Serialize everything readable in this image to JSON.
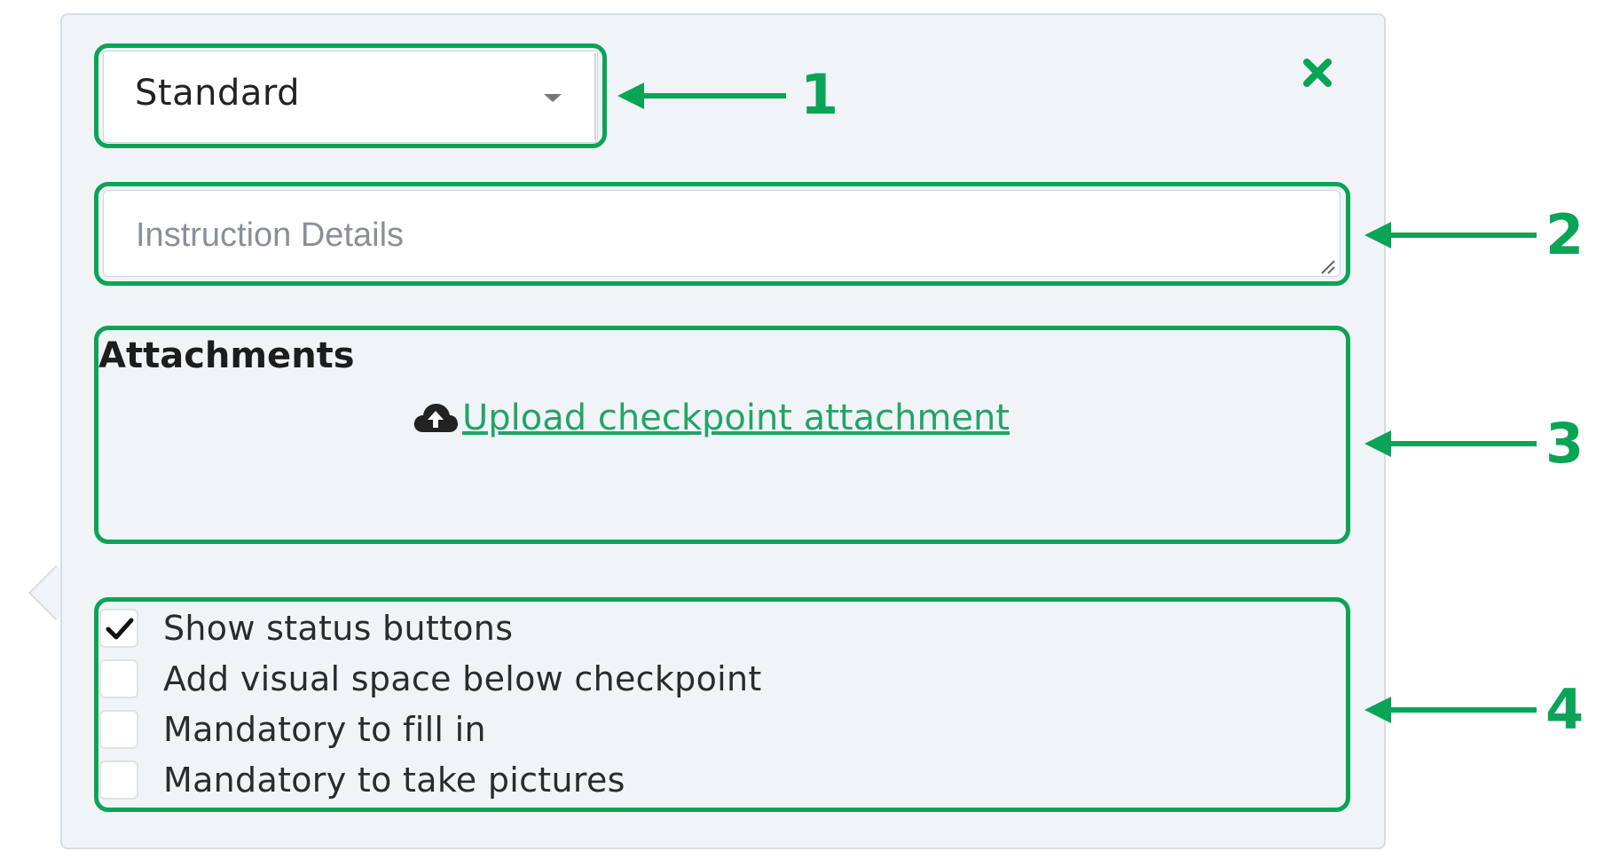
{
  "form": {
    "type_select": {
      "value": "Standard"
    },
    "close_icon": "close-icon",
    "instruction": {
      "placeholder": "Instruction Details",
      "value": ""
    },
    "attachments": {
      "title": "Attachments",
      "upload_icon": "cloud-upload-icon",
      "upload_label": "Upload checkpoint attachment"
    },
    "options": [
      {
        "label": "Show status buttons",
        "checked": true
      },
      {
        "label": "Add visual space below checkpoint",
        "checked": false
      },
      {
        "label": "Mandatory to fill in",
        "checked": false
      },
      {
        "label": "Mandatory to take pictures",
        "checked": false
      }
    ]
  },
  "callouts": [
    "1",
    "2",
    "3",
    "4"
  ],
  "colors": {
    "highlight": "#0aa457",
    "link": "#23a468",
    "panel_bg": "#f1f4f7"
  }
}
